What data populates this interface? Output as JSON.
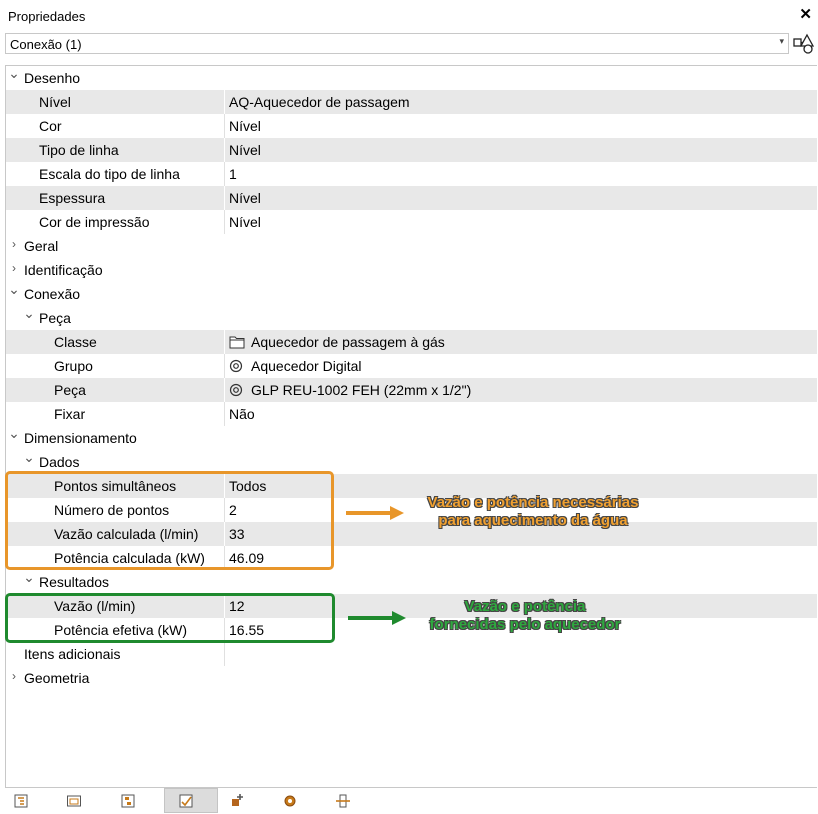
{
  "window": {
    "title": "Propriedades",
    "close_label": "✕"
  },
  "selector": {
    "value": "Conexão (1)"
  },
  "colors": {
    "orange": "#e8962a",
    "green": "#1f8a2e"
  },
  "rows": [
    {
      "type": "group",
      "label": "Desenho",
      "expanded": true,
      "level": 0
    },
    {
      "type": "prop",
      "label": "Nível",
      "value": "AQ-Aquecedor de passagem",
      "level": 1
    },
    {
      "type": "prop",
      "label": "Cor",
      "value": "Nível",
      "level": 1
    },
    {
      "type": "prop",
      "label": "Tipo de linha",
      "value": "Nível",
      "level": 1
    },
    {
      "type": "prop",
      "label": "Escala do tipo de linha",
      "value": "1",
      "level": 1
    },
    {
      "type": "prop",
      "label": "Espessura",
      "value": "Nível",
      "level": 1
    },
    {
      "type": "prop",
      "label": "Cor de impressão",
      "value": "Nível",
      "level": 1
    },
    {
      "type": "group",
      "label": "Geral",
      "expanded": false,
      "level": 0
    },
    {
      "type": "group",
      "label": "Identificação",
      "expanded": false,
      "level": 0
    },
    {
      "type": "group",
      "label": "Conexão",
      "expanded": true,
      "level": 0
    },
    {
      "type": "group",
      "label": "Peça",
      "expanded": true,
      "level": 1
    },
    {
      "type": "prop",
      "label": "Classe",
      "value": "Aquecedor de passagem à gás",
      "icon": "folder-icon",
      "level": 2
    },
    {
      "type": "prop",
      "label": "Grupo",
      "value": "Aquecedor Digital",
      "icon": "target-icon",
      "level": 2
    },
    {
      "type": "prop",
      "label": "Peça",
      "value": "GLP REU-1002 FEH (22mm x 1/2\")",
      "icon": "target-icon",
      "level": 2
    },
    {
      "type": "prop",
      "label": "Fixar",
      "value": "Não",
      "level": 2
    },
    {
      "type": "group",
      "label": "Dimensionamento",
      "expanded": true,
      "level": 0
    },
    {
      "type": "group",
      "label": "Dados",
      "expanded": true,
      "level": 1
    },
    {
      "type": "prop",
      "label": "Pontos simultâneos",
      "value": "Todos",
      "level": 2
    },
    {
      "type": "prop",
      "label": "Número de pontos",
      "value": "2",
      "level": 2
    },
    {
      "type": "prop",
      "label": "Vazão calculada (l/min)",
      "value": "33",
      "level": 2
    },
    {
      "type": "prop",
      "label": "Potência calculada (kW)",
      "value": "46.09",
      "level": 2
    },
    {
      "type": "group",
      "label": "Resultados",
      "expanded": true,
      "level": 1
    },
    {
      "type": "prop",
      "label": "Vazão (l/min)",
      "value": "12",
      "level": 2
    },
    {
      "type": "prop",
      "label": "Potência efetiva (kW)",
      "value": "16.55",
      "level": 2
    },
    {
      "type": "prop",
      "label": "Itens adicionais",
      "value": "",
      "level": 0
    },
    {
      "type": "group",
      "label": "Geometria",
      "expanded": false,
      "level": 0
    }
  ],
  "annotations": {
    "orange_text": [
      "Vazão e potência necessárias",
      "para aquecimento da água"
    ],
    "green_text": [
      "Vazão e potência",
      "fornecidas pelo aquecedor"
    ]
  },
  "toolbar": {
    "icons": [
      "tree-view-icon",
      "window-icon",
      "hierarchy-icon",
      "checklist-icon",
      "add-component-icon",
      "gear-icon",
      "connection-icon"
    ],
    "active_index": 3
  }
}
